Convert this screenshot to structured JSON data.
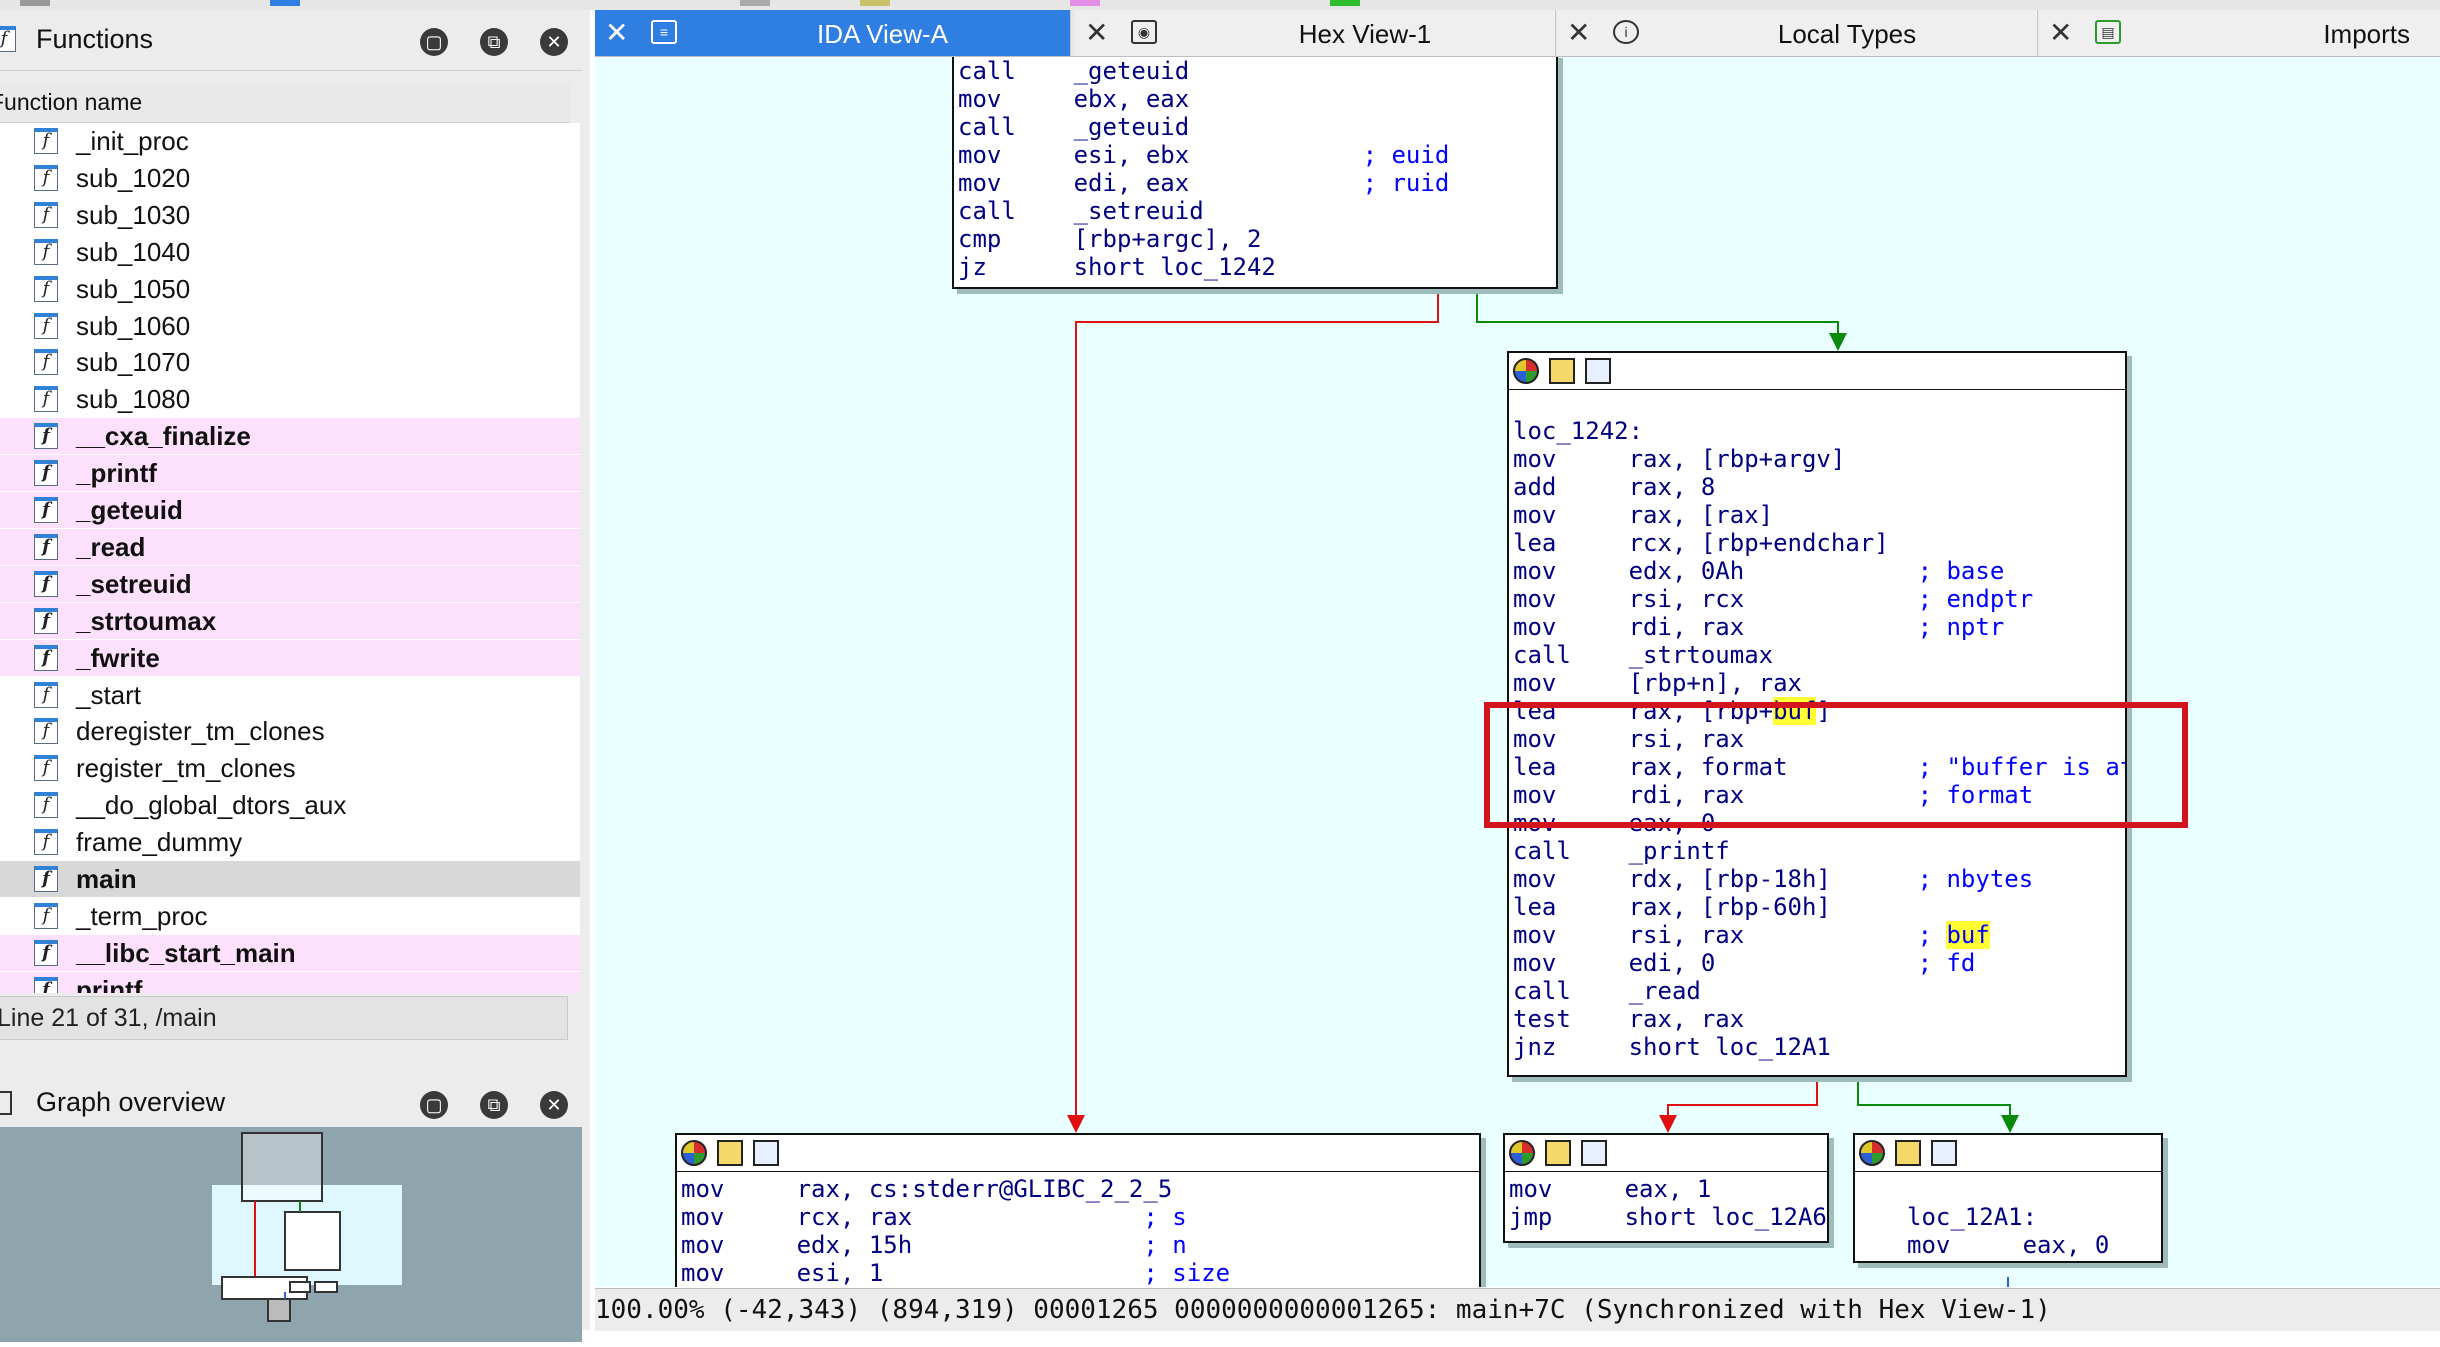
{
  "functions_panel": {
    "title": "Functions",
    "column_header": "Function name",
    "items": [
      {
        "name": "_init_proc",
        "kind": "normal"
      },
      {
        "name": "sub_1020",
        "kind": "normal"
      },
      {
        "name": "sub_1030",
        "kind": "normal"
      },
      {
        "name": "sub_1040",
        "kind": "normal"
      },
      {
        "name": "sub_1050",
        "kind": "normal"
      },
      {
        "name": "sub_1060",
        "kind": "normal"
      },
      {
        "name": "sub_1070",
        "kind": "normal"
      },
      {
        "name": "sub_1080",
        "kind": "normal"
      },
      {
        "name": "__cxa_finalize",
        "kind": "lib"
      },
      {
        "name": "_printf",
        "kind": "lib"
      },
      {
        "name": "_geteuid",
        "kind": "lib"
      },
      {
        "name": "_read",
        "kind": "lib"
      },
      {
        "name": "_setreuid",
        "kind": "lib"
      },
      {
        "name": "_strtoumax",
        "kind": "lib"
      },
      {
        "name": "_fwrite",
        "kind": "lib"
      },
      {
        "name": "_start",
        "kind": "normal"
      },
      {
        "name": "deregister_tm_clones",
        "kind": "normal"
      },
      {
        "name": "register_tm_clones",
        "kind": "normal"
      },
      {
        "name": "__do_global_dtors_aux",
        "kind": "normal"
      },
      {
        "name": "frame_dummy",
        "kind": "normal"
      },
      {
        "name": "main",
        "kind": "selected"
      },
      {
        "name": "_term_proc",
        "kind": "normal"
      },
      {
        "name": "__libc_start_main",
        "kind": "lib"
      },
      {
        "name": "printf",
        "kind": "lib"
      }
    ],
    "status": "Line 21 of 31, /main"
  },
  "graph_overview": {
    "title": "Graph overview"
  },
  "tabs": [
    {
      "label": "IDA View-A",
      "active": true,
      "icon": "listing-icon"
    },
    {
      "label": "Hex View-1",
      "active": false,
      "icon": "hex-icon"
    },
    {
      "label": "Local Types",
      "active": false,
      "icon": "info-icon"
    },
    {
      "label": "Imports",
      "active": false,
      "icon": "imports-icon"
    }
  ],
  "blocks": {
    "top": [
      [
        "call",
        "_geteuid",
        ""
      ],
      [
        "mov",
        "ebx, eax",
        ""
      ],
      [
        "call",
        "_geteuid",
        ""
      ],
      [
        "mov",
        "esi, ebx",
        "; euid"
      ],
      [
        "mov",
        "edi, eax",
        "; ruid"
      ],
      [
        "call",
        "_setreuid",
        ""
      ],
      [
        "cmp",
        "[rbp+argc], 2",
        ""
      ],
      [
        "jz",
        "short loc_1242",
        ""
      ]
    ],
    "loc_1242": {
      "label": "loc_1242:",
      "lines": [
        [
          "mov",
          "rax, [rbp+argv]",
          ""
        ],
        [
          "add",
          "rax, 8",
          ""
        ],
        [
          "mov",
          "rax, [rax]",
          ""
        ],
        [
          "lea",
          "rcx, [rbp+endchar]",
          ""
        ],
        [
          "mov",
          "edx, 0Ah",
          "; base"
        ],
        [
          "mov",
          "rsi, rcx",
          "; endptr"
        ],
        [
          "mov",
          "rdi, rax",
          "; nptr"
        ],
        [
          "call",
          "_strtoumax",
          ""
        ],
        [
          "mov",
          "[rbp+n], rax",
          ""
        ],
        [
          "lea",
          "rax, [rbp+buf]",
          ""
        ],
        [
          "mov",
          "rsi, rax",
          ""
        ],
        [
          "lea",
          "rax, format",
          "; \"buffer is at %p\\n\""
        ],
        [
          "mov",
          "rdi, rax",
          "; format"
        ],
        [
          "mov",
          "eax, 0",
          ""
        ],
        [
          "call",
          "_printf",
          ""
        ],
        [
          "mov",
          "rdx, [rbp-18h]",
          "; nbytes"
        ],
        [
          "lea",
          "rax, [rbp-60h]",
          ""
        ],
        [
          "mov",
          "rsi, rax",
          "; buf"
        ],
        [
          "mov",
          "edi, 0",
          "; fd"
        ],
        [
          "call",
          "_read",
          ""
        ],
        [
          "test",
          "rax, rax",
          ""
        ],
        [
          "jnz",
          "short loc_12A1",
          ""
        ]
      ]
    },
    "bottom_left": [
      [
        "mov",
        "rax, cs:stderr@GLIBC_2_2_5",
        ""
      ],
      [
        "mov",
        "rcx, rax",
        "; s"
      ],
      [
        "mov",
        "edx, 15h",
        "; n"
      ],
      [
        "mov",
        "esi, 1",
        "; size"
      ]
    ],
    "bottom_mid": [
      [
        "mov",
        "eax, 1",
        ""
      ],
      [
        "jmp",
        "short loc_12A6",
        ""
      ]
    ],
    "bottom_right": {
      "label": "loc_12A1:",
      "lines": [
        [
          "mov",
          "eax, 0",
          ""
        ]
      ]
    }
  },
  "status_bar": "100.00% (-42,343) (894,319) 00001265 0000000000001265: main+7C (Synchronized with Hex View-1)",
  "colors": {
    "edge_true": "#0a8a0a",
    "edge_false": "#e01010",
    "highlight_box": "#d3141c",
    "lib_row": "#fde0fb",
    "graph_bg": "#eaffff",
    "tab_active": "#2f7ee2"
  }
}
